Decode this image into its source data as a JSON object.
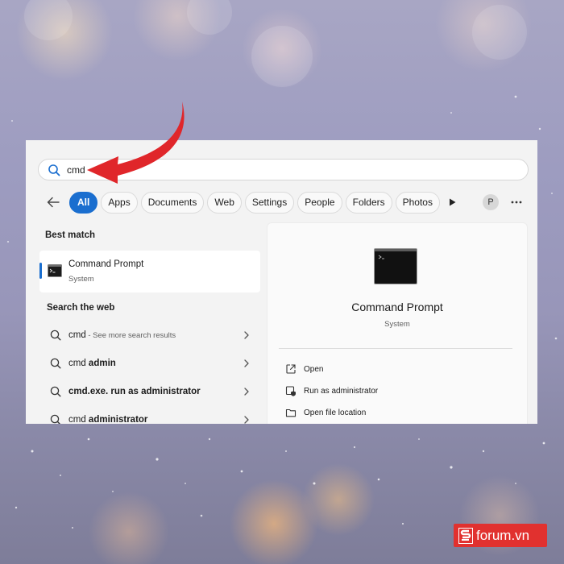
{
  "search": {
    "query": "cmd",
    "icon": "search-icon"
  },
  "filters": {
    "chips": [
      "All",
      "Apps",
      "Documents",
      "Web",
      "Settings",
      "People",
      "Folders",
      "Photos"
    ],
    "active": "All",
    "avatar_letter": "P"
  },
  "best_match": {
    "heading": "Best match",
    "name": "Command Prompt",
    "type": "System"
  },
  "web": {
    "heading": "Search the web",
    "results": [
      {
        "prefix": "cmd",
        "bold": "",
        "sub": " - See more search results"
      },
      {
        "prefix": "cmd ",
        "bold": "admin",
        "sub": ""
      },
      {
        "prefix": "",
        "bold": "cmd.exe. run as administrator",
        "sub": ""
      },
      {
        "prefix": "cmd ",
        "bold": "administrator",
        "sub": ""
      }
    ]
  },
  "preview": {
    "title": "Command Prompt",
    "subtitle": "System",
    "actions": [
      {
        "label": "Open",
        "icon": "open-external-icon"
      },
      {
        "label": "Run as administrator",
        "icon": "shield-admin-icon"
      },
      {
        "label": "Open file location",
        "icon": "folder-icon"
      }
    ]
  },
  "watermark": {
    "text": "forum.vn"
  },
  "colors": {
    "accent": "#1a6ecf",
    "arrow": "#e0262a",
    "watermark": "#e1312f"
  }
}
